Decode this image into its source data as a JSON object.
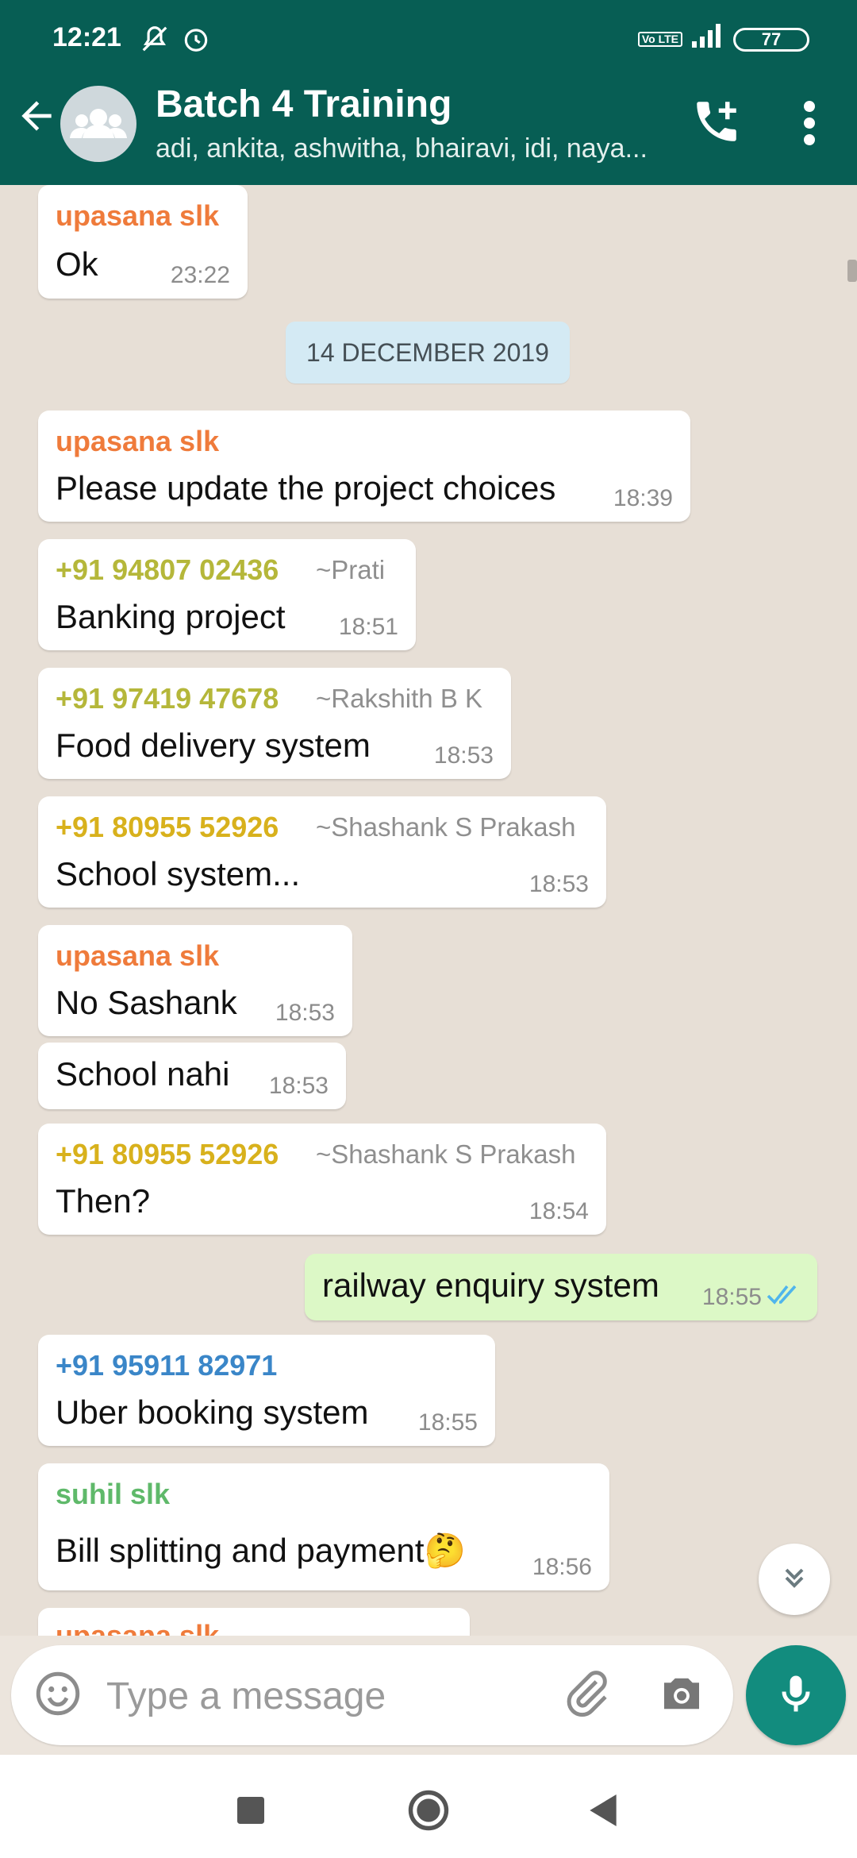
{
  "status_bar": {
    "time": "12:21",
    "battery": "77",
    "volte": "Vo LTE",
    "icons": [
      "notifications-muted-icon",
      "alarm-icon",
      "volte-icon",
      "signal-icon",
      "battery-icon"
    ]
  },
  "header": {
    "title": "Batch 4 Training",
    "participants": "adi, ankita, ashwitha, bhairavi, idi, naya...",
    "icons": [
      "back-arrow-icon",
      "group-avatar-icon",
      "add-call-icon",
      "more-vert-icon"
    ],
    "color": "#075e54"
  },
  "chat": {
    "date_divider": "14 DECEMBER 2019",
    "messages": [
      {
        "sender": "upasana slk",
        "text": "Ok",
        "time": "23:22"
      },
      {
        "sender": "upasana slk",
        "text": "Please update the project choices",
        "time": "18:39"
      },
      {
        "sender": "+91 94807 02436",
        "alias": "~Prati",
        "text": "Banking project",
        "time": "18:51"
      },
      {
        "sender": "+91 97419 47678",
        "alias": "~Rakshith B K",
        "text": "Food delivery system",
        "time": "18:53"
      },
      {
        "sender": "+91 80955 52926",
        "alias": "~Shashank S Prakash",
        "text": "School system...",
        "time": "18:53"
      },
      {
        "sender": "upasana slk",
        "text": "No Sashank",
        "time": "18:53"
      },
      {
        "text": "School nahi",
        "time": "18:53"
      },
      {
        "sender": "+91 80955 52926",
        "alias": "~Shashank S Prakash",
        "text": "Then?",
        "time": "18:54"
      },
      {
        "text": "railway enquiry system",
        "time": "18:55",
        "outgoing": true,
        "status": "read"
      },
      {
        "sender": "+91 95911 82971",
        "text": "Uber booking system",
        "time": "18:55"
      },
      {
        "sender": "suhil slk",
        "text": "Bill splitting and payment",
        "emoji": "🤔",
        "time": "18:56"
      },
      {
        "sender": "upasana slk",
        "text": "",
        "time": ""
      }
    ]
  },
  "composer": {
    "placeholder": "Type a message",
    "icons": [
      "emoji-icon",
      "attach-icon",
      "camera-icon",
      "mic-icon"
    ],
    "accent": "#128c7e"
  },
  "colors": {
    "upasana": "#ef7b3b",
    "olive": "#b5b73a",
    "gold": "#d8b11c",
    "blue": "#3a86c8",
    "green": "#5fb96a",
    "outgoing_bubble": "#dcf8c6",
    "read_ticks": "#4fb5ec"
  },
  "nav": {
    "icons": [
      "recents-square-icon",
      "home-circle-icon",
      "back-triangle-icon"
    ]
  }
}
